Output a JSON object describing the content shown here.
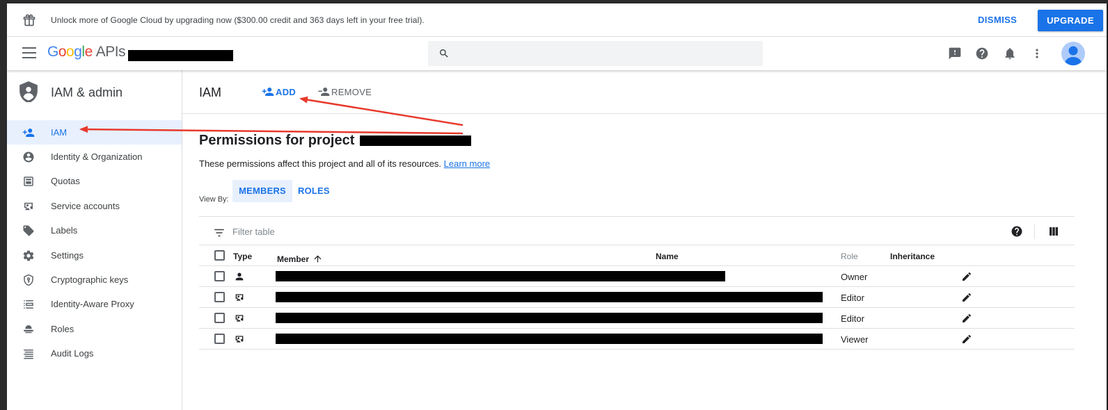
{
  "banner": {
    "message": "Unlock more of Google Cloud by upgrading now ($300.00 credit and 363 days left in your free trial).",
    "dismiss_label": "DISMISS",
    "upgrade_label": "UPGRADE",
    "gift_icon": "gift-icon"
  },
  "topbar": {
    "logo_google": [
      "G",
      "o",
      "o",
      "g",
      "l",
      "e"
    ],
    "logo_apis": "APIs",
    "icons": [
      "menu-icon",
      "search-icon",
      "feedback-icon",
      "help-icon",
      "notifications-icon",
      "more-vert-icon",
      "account-avatar"
    ]
  },
  "sidebar": {
    "title": "IAM & admin",
    "items": [
      {
        "label": "IAM",
        "icon": "person-add-icon",
        "active": true
      },
      {
        "label": "Identity & Organization",
        "icon": "account-circle-icon"
      },
      {
        "label": "Quotas",
        "icon": "quotas-icon"
      },
      {
        "label": "Service accounts",
        "icon": "service-account-icon"
      },
      {
        "label": "Labels",
        "icon": "label-icon"
      },
      {
        "label": "Settings",
        "icon": "settings-icon"
      },
      {
        "label": "Cryptographic keys",
        "icon": "shield-key-icon"
      },
      {
        "label": "Identity-Aware Proxy",
        "icon": "proxy-icon"
      },
      {
        "label": "Roles",
        "icon": "roles-icon"
      },
      {
        "label": "Audit Logs",
        "icon": "list-icon"
      }
    ]
  },
  "main": {
    "page_title": "IAM",
    "add_label": "ADD",
    "remove_label": "REMOVE",
    "heading": "Permissions for project",
    "subtitle": "These permissions affect this project and all of its resources.",
    "learn_more": "Learn more",
    "view_by": "View By:",
    "tabs": [
      "MEMBERS",
      "ROLES"
    ],
    "filter_placeholder": "Filter table",
    "columns": [
      "Type",
      "Member",
      "Name",
      "Role",
      "Inheritance"
    ],
    "rows": [
      {
        "type_icon": "person-icon",
        "role": "Owner"
      },
      {
        "type_icon": "service-account-icon",
        "role": "Editor"
      },
      {
        "type_icon": "service-account-icon",
        "role": "Editor"
      },
      {
        "type_icon": "service-account-icon",
        "role": "Viewer"
      }
    ]
  },
  "colors": {
    "accent": "#1a73e8",
    "active_bg": "#e8f0fe",
    "annotation_arrow": "#e8392c"
  }
}
